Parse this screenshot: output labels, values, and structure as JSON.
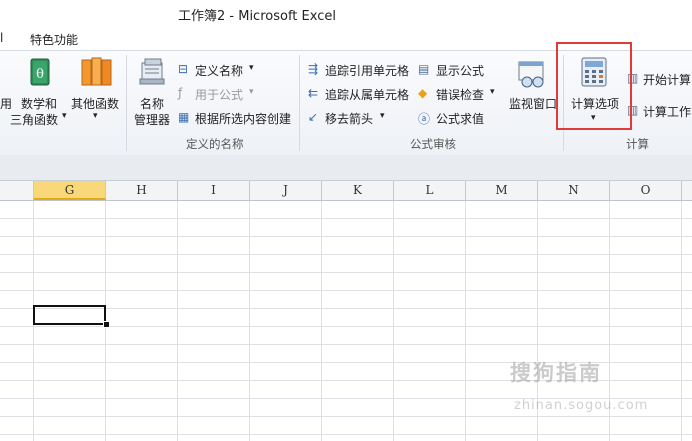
{
  "window": {
    "title": "工作簿2 - Microsoft Excel"
  },
  "tabs": {
    "left_fragment": "l",
    "special": "特色功能"
  },
  "ribbon": {
    "func_lib": {
      "partial_label": "用",
      "math_label1": "数学和",
      "math_label2": "三角函数",
      "other_label": "其他函数"
    },
    "names": {
      "name_manager_1": "名称",
      "name_manager_2": "管理器",
      "define_name": "定义名称",
      "use_in_formula": "用于公式",
      "create_from_selection": "根据所选内容创建",
      "group": "定义的名称"
    },
    "audit": {
      "trace_precedents": "追踪引用单元格",
      "trace_dependents": "追踪从属单元格",
      "remove_arrows": "移去箭头",
      "show_formulas": "显示公式",
      "error_checking": "错误检查",
      "evaluate_formula": "公式求值",
      "watch_window": "监视窗口",
      "group": "公式审核"
    },
    "calc": {
      "calc_options": "计算选项",
      "calc_now": "开始计算",
      "calc_sheet": "计算工作",
      "group": "计算"
    }
  },
  "columns": [
    {
      "name": "F",
      "label": ""
    },
    {
      "name": "G",
      "label": "G"
    },
    {
      "name": "H",
      "label": "H"
    },
    {
      "name": "I",
      "label": "I"
    },
    {
      "name": "J",
      "label": "J"
    },
    {
      "name": "K",
      "label": "K"
    },
    {
      "name": "L",
      "label": "L"
    },
    {
      "name": "M",
      "label": "M"
    },
    {
      "name": "N",
      "label": "N"
    },
    {
      "name": "O",
      "label": "O"
    }
  ],
  "watermark": {
    "text": "搜狗指南",
    "url": "zhinan.sogou.com"
  },
  "colors": {
    "highlight": "#e03a3a",
    "selected_col": "#f9d87a"
  }
}
